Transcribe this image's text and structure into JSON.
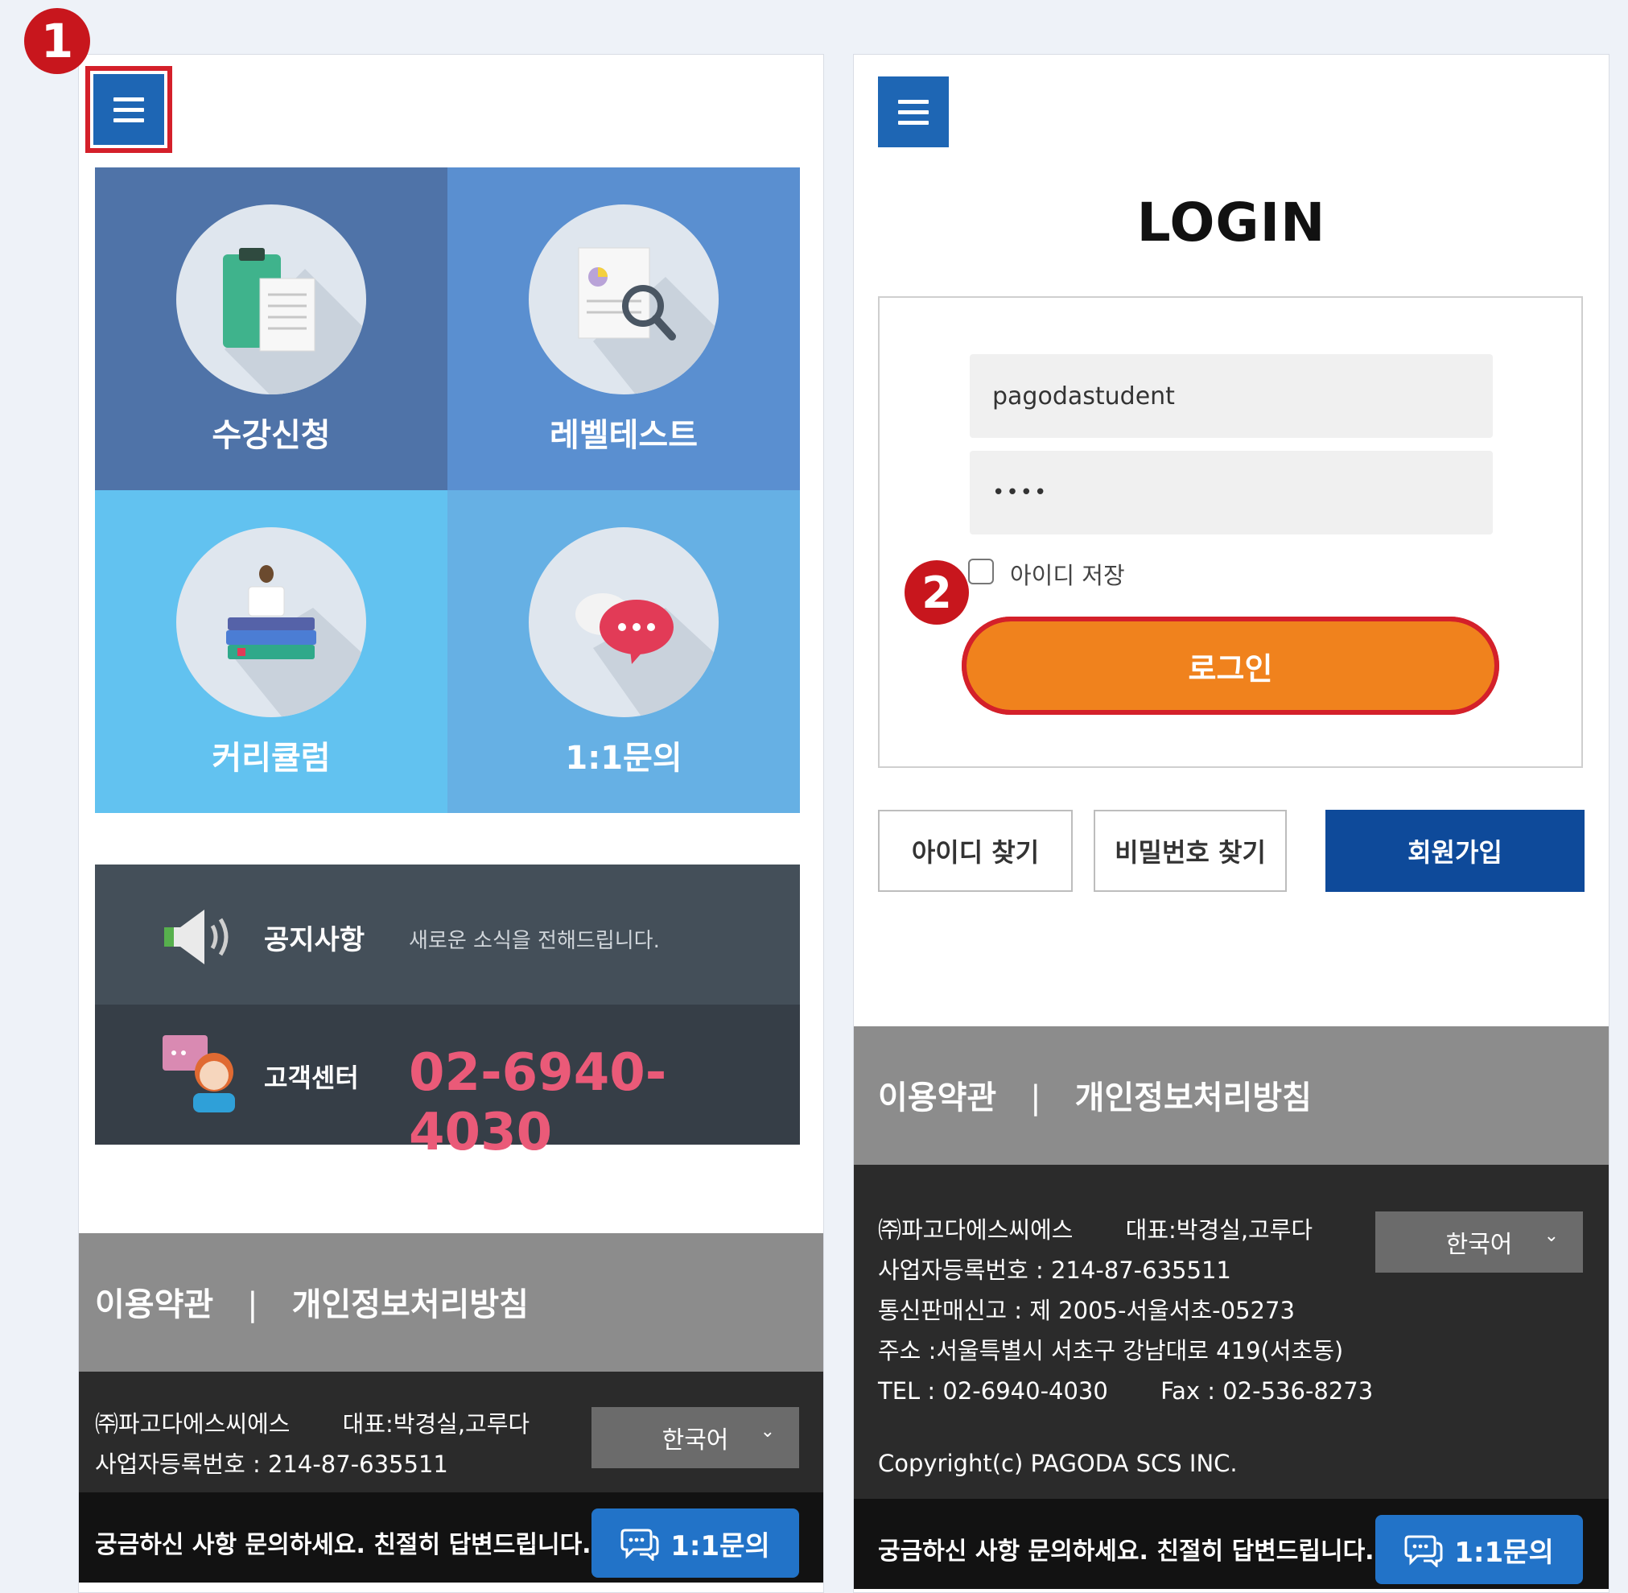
{
  "steps": [
    "1",
    "2"
  ],
  "left": {
    "tiles": [
      {
        "label": "수강신청",
        "color": "#4f73a8"
      },
      {
        "label": "레벨테스트",
        "color": "#5a8fd0"
      },
      {
        "label": "커리큘럼",
        "color": "#62c2f0"
      },
      {
        "label": "1:1문의",
        "color": "#66b0e4"
      }
    ],
    "notice": {
      "title": "공지사항",
      "subtitle": "새로운 소식을 전해드립니다."
    },
    "cs": {
      "title": "고객센터",
      "phone": "02-6940-4030"
    },
    "footer": {
      "terms": "이용약관",
      "sep": "|",
      "privacy": "개인정보처리방침",
      "company": "㈜파고다에스씨에스",
      "ceo": "대표:박경실,고루다",
      "biz": "사업자등록번호 : 214-87-635511",
      "lang": "한국어",
      "chevron": "⌄"
    },
    "bottom": {
      "question": "궁금하신 사항 문의하세요. 친절히 답변드립니다.",
      "chat": "1:1문의"
    }
  },
  "right": {
    "title": "LOGIN",
    "username": "pagodastudent",
    "password": "••••",
    "remember": "아이디 저장",
    "login_btn": "로그인",
    "find_id": "아이디 찾기",
    "find_pw": "비밀번호 찾기",
    "join": "회원가입",
    "footer": {
      "terms": "이용약관",
      "sep": "|",
      "privacy": "개인정보처리방침",
      "company": "㈜파고다에스씨에스",
      "ceo": "대표:박경실,고루다",
      "biz": "사업자등록번호 : 214-87-635511",
      "telecom": "통신판매신고 : 제 2005-서울서초-05273",
      "address": "주소 :서울특별시 서초구 강남대로 419(서초동)",
      "tel": "TEL : 02-6940-4030",
      "fax": "Fax : 02-536-8273",
      "copyright": "Copyright(c) PAGODA SCS INC.",
      "lang": "한국어",
      "chevron": "⌄"
    },
    "bottom": {
      "question": "궁금하신 사항 문의하세요. 친절히 답변드립니다.",
      "chat": "1:1문의"
    }
  }
}
